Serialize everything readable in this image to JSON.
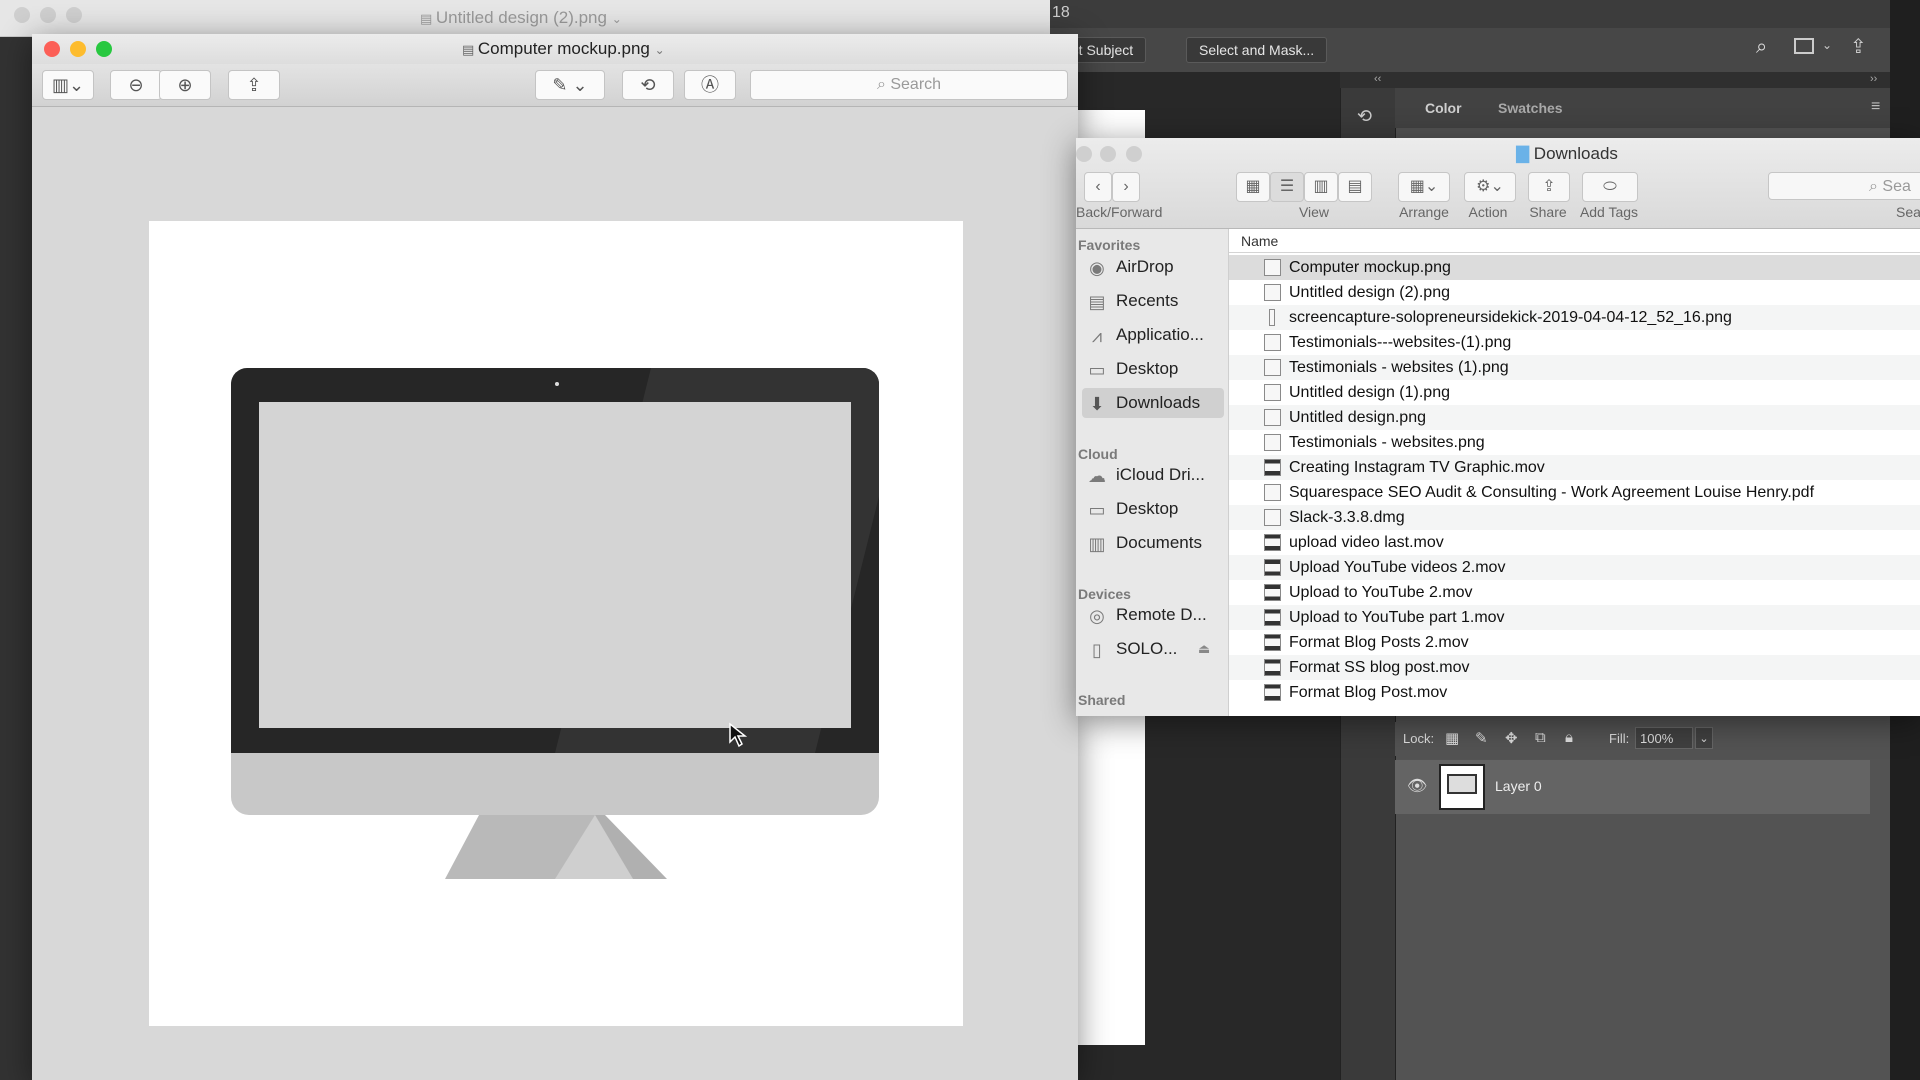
{
  "photoshop": {
    "title_fragment": "18",
    "select_subject_label": "elect Subject",
    "select_mask_label": "Select and Mask...",
    "panel_tabs": [
      "Color",
      "Swatches"
    ],
    "lock_label": "Lock:",
    "fill_label": "Fill:",
    "fill_value": "100%",
    "layer_name": "Layer 0",
    "collapse_left": "‹‹",
    "collapse_right": "››"
  },
  "preview_back": {
    "title": "Untitled design (2).png"
  },
  "preview": {
    "title": "Computer mockup.png",
    "search_placeholder": "Search",
    "colors": {
      "close": "#fc5f57",
      "minimize": "#fdbc2e",
      "zoom": "#28c840"
    }
  },
  "finder": {
    "title": "Downloads",
    "toolbar": {
      "back_forward": "Back/Forward",
      "view": "View",
      "arrange": "Arrange",
      "action": "Action",
      "share": "Share",
      "add_tags": "Add Tags",
      "search_placeholder": "Sea",
      "search_label": "Sea"
    },
    "sidebar": {
      "favorites_header": "Favorites",
      "favorites": [
        "AirDrop",
        "Recents",
        "Applicatio...",
        "Desktop",
        "Downloads"
      ],
      "cloud_header": "Cloud",
      "cloud": [
        "iCloud Dri...",
        "Desktop",
        "Documents"
      ],
      "devices_header": "Devices",
      "devices": [
        "Remote D...",
        "SOLO..."
      ],
      "shared_header": "Shared"
    },
    "column_name": "Name",
    "files": [
      "Computer mockup.png",
      "Untitled design (2).png",
      "screencapture-solopreneursidekick-2019-04-04-12_52_16.png",
      "Testimonials---websites-(1).png",
      "Testimonials - websites (1).png",
      "Untitled design (1).png",
      "Untitled design.png",
      "Testimonials - websites.png",
      "Creating Instagram TV Graphic.mov",
      "Squarespace SEO Audit & Consulting - Work Agreement Louise Henry.pdf",
      "Slack-3.3.8.dmg",
      "upload video last.mov",
      "Upload YouTube videos 2.mov",
      "Upload to YouTube 2.mov",
      "Upload to YouTube part 1.mov",
      "Format Blog Posts 2.mov",
      "Format SS blog post.mov",
      "Format Blog Post.mov"
    ]
  }
}
